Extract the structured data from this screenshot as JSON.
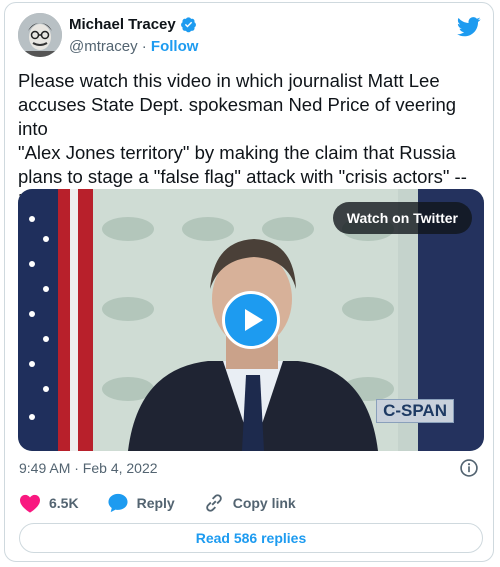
{
  "author": {
    "name": "Michael Tracey",
    "handle": "@mtracey",
    "separator": "·",
    "follow_label": "Follow"
  },
  "tweet": {
    "text": "Please watch this video in which journalist Matt Lee\naccuses State Dept. spokesman Ned Price of veering into\n\"Alex Jones territory\" by making the claim that Russia\nplans to stage a \"false flag\" attack with \"crisis actors\" --\nPrice then sneeringly calls Lee a Russian propagandist"
  },
  "media": {
    "watch_label": "Watch on Twitter",
    "watermark": "C-SPAN"
  },
  "meta": {
    "timestamp": "9:49 AM · Feb 4, 2022"
  },
  "actions": {
    "likes": "6.5K",
    "reply_label": "Reply",
    "copy_label": "Copy link",
    "read_replies": "Read 586 replies"
  },
  "colors": {
    "accent": "#1d9bf0",
    "like": "#f91880",
    "muted": "#536471"
  },
  "icons": [
    "twitter-bird-icon",
    "verified-badge-icon",
    "play-icon",
    "info-icon",
    "heart-icon",
    "reply-bubble-icon",
    "link-icon"
  ]
}
